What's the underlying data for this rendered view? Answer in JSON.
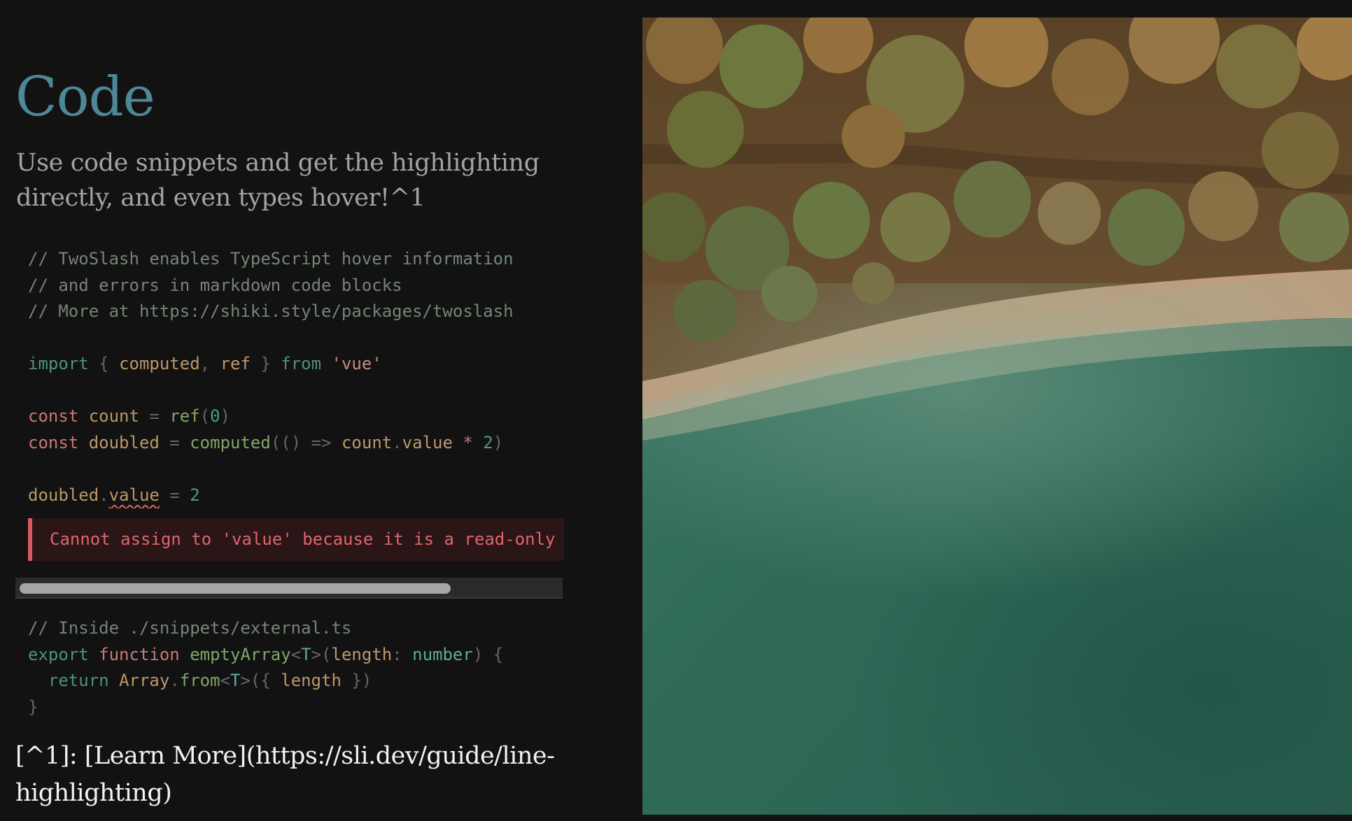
{
  "slide": {
    "title": "Code",
    "subtitle": "Use code snippets and get the highlighting directly, and even types hover!^1",
    "footnote": "[^1]: [Learn More](https://sli.dev/guide/line-highlighting)"
  },
  "code_block_1": {
    "lines": [
      [
        {
          "t": "// TwoSlash enables TypeScript hover information",
          "c": "cm"
        }
      ],
      [
        {
          "t": "// and errors in markdown code blocks",
          "c": "cm"
        }
      ],
      [
        {
          "t": "// More at https://shiki.style/packages/twoslash",
          "c": "cm"
        }
      ],
      [],
      [
        {
          "t": "import",
          "c": "kw"
        },
        {
          "t": " { ",
          "c": "pn"
        },
        {
          "t": "computed",
          "c": "var"
        },
        {
          "t": ", ",
          "c": "pn"
        },
        {
          "t": "ref",
          "c": "var"
        },
        {
          "t": " } ",
          "c": "pn"
        },
        {
          "t": "from",
          "c": "kw"
        },
        {
          "t": " ",
          "c": "pn"
        },
        {
          "t": "'vue'",
          "c": "str"
        }
      ],
      [],
      [
        {
          "t": "const",
          "c": "op"
        },
        {
          "t": " ",
          "c": "default"
        },
        {
          "t": "count",
          "c": "var"
        },
        {
          "t": " = ",
          "c": "pn"
        },
        {
          "t": "ref",
          "c": "fn"
        },
        {
          "t": "(",
          "c": "pn"
        },
        {
          "t": "0",
          "c": "num"
        },
        {
          "t": ")",
          "c": "pn"
        }
      ],
      [
        {
          "t": "const",
          "c": "op"
        },
        {
          "t": " ",
          "c": "default"
        },
        {
          "t": "doubled",
          "c": "var"
        },
        {
          "t": " = ",
          "c": "pn"
        },
        {
          "t": "computed",
          "c": "fn"
        },
        {
          "t": "(() => ",
          "c": "pn"
        },
        {
          "t": "count",
          "c": "var"
        },
        {
          "t": ".",
          "c": "pn"
        },
        {
          "t": "value",
          "c": "var"
        },
        {
          "t": " * ",
          "c": "op"
        },
        {
          "t": "2",
          "c": "num"
        },
        {
          "t": ")",
          "c": "pn"
        }
      ],
      [],
      [
        {
          "t": "doubled",
          "c": "var"
        },
        {
          "t": ".",
          "c": "pn"
        },
        {
          "t": "value",
          "c": "var squiggle"
        },
        {
          "t": " = ",
          "c": "pn"
        },
        {
          "t": "2",
          "c": "num"
        }
      ]
    ],
    "error_message": "Cannot assign to 'value' because it is a read-only property."
  },
  "code_block_2": {
    "lines": [
      [
        {
          "t": "// Inside ./snippets/external.ts",
          "c": "cm"
        }
      ],
      [
        {
          "t": "export",
          "c": "kw"
        },
        {
          "t": " ",
          "c": "default"
        },
        {
          "t": "function",
          "c": "op"
        },
        {
          "t": " ",
          "c": "default"
        },
        {
          "t": "emptyArray",
          "c": "fn"
        },
        {
          "t": "<",
          "c": "pn"
        },
        {
          "t": "T",
          "c": "tp"
        },
        {
          "t": ">(",
          "c": "pn"
        },
        {
          "t": "length",
          "c": "var"
        },
        {
          "t": ": ",
          "c": "pn"
        },
        {
          "t": "number",
          "c": "ty"
        },
        {
          "t": ") {",
          "c": "pn"
        }
      ],
      [
        {
          "t": "  ",
          "c": "default"
        },
        {
          "t": "return",
          "c": "kw"
        },
        {
          "t": " ",
          "c": "default"
        },
        {
          "t": "Array",
          "c": "var"
        },
        {
          "t": ".",
          "c": "pn"
        },
        {
          "t": "from",
          "c": "fn"
        },
        {
          "t": "<",
          "c": "pn"
        },
        {
          "t": "T",
          "c": "tp"
        },
        {
          "t": ">({ ",
          "c": "pn"
        },
        {
          "t": "length",
          "c": "var"
        },
        {
          "t": " })",
          "c": "pn"
        }
      ],
      [
        {
          "t": "}",
          "c": "pn"
        }
      ]
    ]
  },
  "scrollbar": {
    "visible_fraction": 0.8
  },
  "photo": {
    "subject": "aerial-forest-lake-photo"
  },
  "colors": {
    "background": "#121212",
    "title": "#4e8797",
    "subtitle": "#a3a3a3",
    "footnote": "#f2f2f2",
    "error": "#e0656b",
    "error_bg": "#2a1517",
    "error_bar": "#d65a5f"
  }
}
